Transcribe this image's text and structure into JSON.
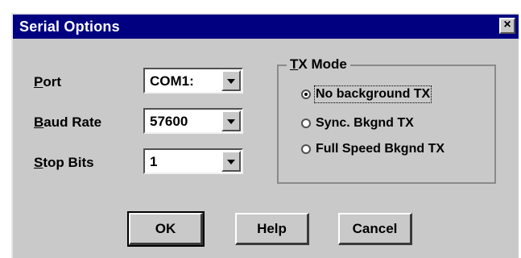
{
  "window": {
    "title": "Serial Options",
    "close_glyph": "×"
  },
  "fields": {
    "port": {
      "label_underline": "P",
      "label_rest": "ort",
      "value": "COM1:"
    },
    "baud_rate": {
      "label_underline": "B",
      "label_rest": "aud Rate",
      "value": "57600"
    },
    "stop_bits": {
      "label_underline": "S",
      "label_rest": "top Bits",
      "value": "1"
    }
  },
  "tx_mode": {
    "title_underline": "T",
    "title_rest": "X Mode",
    "options": [
      {
        "label": "No background TX",
        "selected": true
      },
      {
        "label": "Sync. Bkgnd TX",
        "selected": false
      },
      {
        "label": "Full Speed Bkgnd TX",
        "selected": false
      }
    ]
  },
  "buttons": {
    "ok": "OK",
    "help": "Help",
    "cancel": "Cancel"
  }
}
